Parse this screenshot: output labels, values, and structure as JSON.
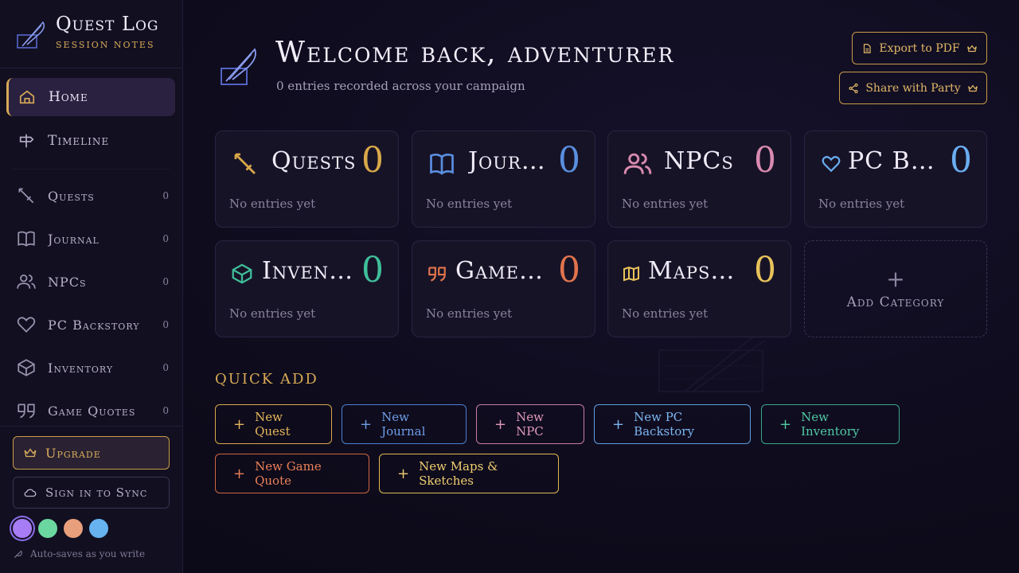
{
  "app": {
    "title": "Quest Log",
    "subtitle": "Session Notes"
  },
  "nav": [
    {
      "label": "Home",
      "icon": "home-icon",
      "active": true
    },
    {
      "label": "Timeline",
      "icon": "signpost-icon",
      "active": false
    }
  ],
  "categories": [
    {
      "label": "Quests",
      "count": "0",
      "icon": "sword-icon",
      "color": "#d9a94a"
    },
    {
      "label": "Journal",
      "count": "0",
      "icon": "book-icon",
      "color": "#5a8fe0"
    },
    {
      "label": "NPCs",
      "count": "0",
      "icon": "users-icon",
      "color": "#d98bb0"
    },
    {
      "label": "PC Backstory",
      "count": "0",
      "icon": "heart-icon",
      "color": "#6aaef0"
    },
    {
      "label": "Inventory",
      "count": "0",
      "icon": "box-icon",
      "color": "#3fbf9a"
    },
    {
      "label": "Game Quotes",
      "count": "0",
      "icon": "quote-icon",
      "color": "#e0744c"
    },
    {
      "label": "Maps & Sketches",
      "count": "0",
      "icon": "map-icon",
      "color": "#e8c35a"
    }
  ],
  "sidebar_footer": {
    "upgrade_label": "Upgrade",
    "sync_label": "Sign in to Sync",
    "swatches": [
      "#a77cf5",
      "#6bd6a0",
      "#e89f7c",
      "#66b3f0"
    ],
    "autosave_text": "Auto-saves as you write"
  },
  "header": {
    "title": "Welcome back, adventurer",
    "subtitle": "0 entries recorded across your campaign",
    "export_label": "Export to PDF",
    "share_label": "Share with Party"
  },
  "cards": [
    {
      "title": "Quests",
      "count": "0",
      "empty": "No entries yet"
    },
    {
      "title": "Journal",
      "count": "0",
      "empty": "No entries yet"
    },
    {
      "title": "NPCs",
      "count": "0",
      "empty": "No entries yet"
    },
    {
      "title": "PC Backstory",
      "count": "0",
      "empty": "No entries yet"
    },
    {
      "title": "Inventory",
      "count": "0",
      "empty": "No entries yet"
    },
    {
      "title": "Game Quotes",
      "count": "0",
      "empty": "No entries yet"
    },
    {
      "title": "Maps & Sketches",
      "count": "0",
      "empty": "No entries yet"
    }
  ],
  "add_category_label": "Add Category",
  "quick_add": {
    "title": "Quick Add",
    "buttons": [
      {
        "label": "New Quest",
        "color": "#d9a94a"
      },
      {
        "label": "New Journal",
        "color": "#5a8fe0"
      },
      {
        "label": "New NPC",
        "color": "#d98bb0"
      },
      {
        "label": "New PC Backstory",
        "color": "#6aaef0"
      },
      {
        "label": "New Inventory",
        "color": "#3fbf9a"
      },
      {
        "label": "New Game Quote",
        "color": "#e0744c"
      },
      {
        "label": "New Maps & Sketches",
        "color": "#e8c35a"
      }
    ]
  }
}
